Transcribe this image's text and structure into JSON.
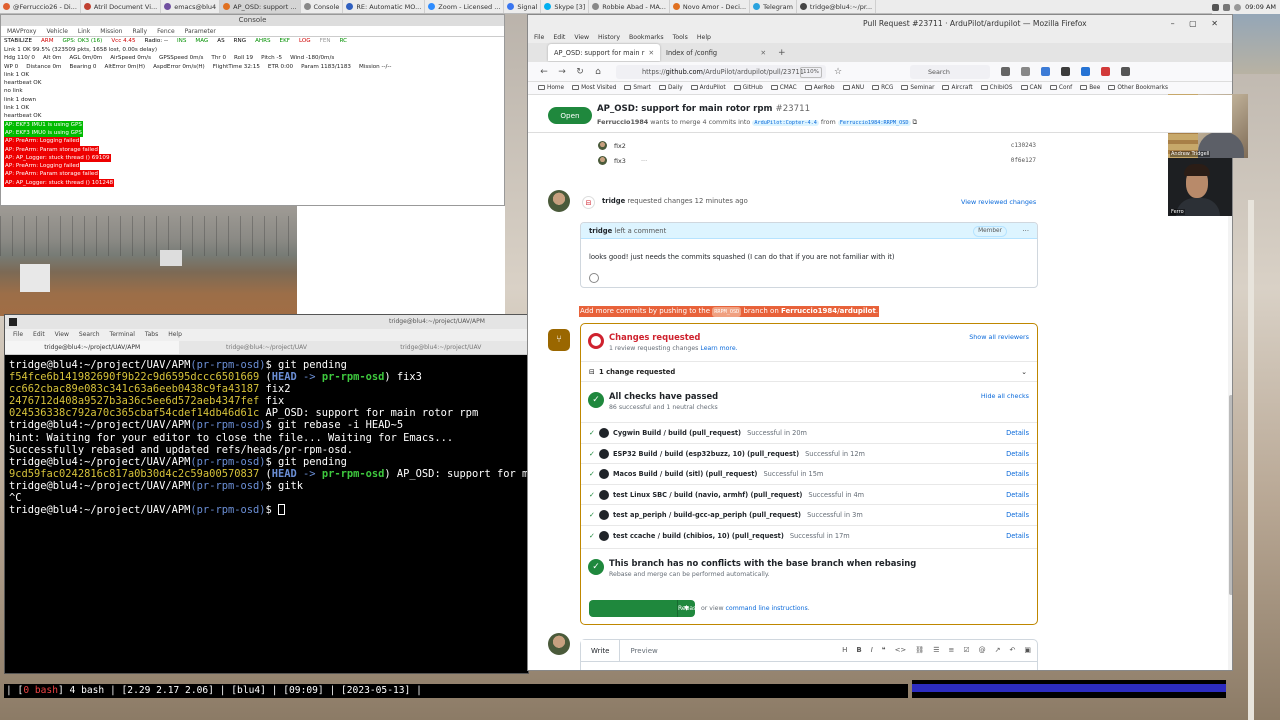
{
  "taskbar": {
    "items": [
      {
        "label": "@Ferruccio26 - Di...",
        "color": "#e06030"
      },
      {
        "label": "Atril Document Vi...",
        "color": "#c04030"
      },
      {
        "label": "emacs@blu4",
        "color": "#7050a0"
      },
      {
        "label": "AP_OSD: support ...",
        "color": "#e07020"
      },
      {
        "label": "Console",
        "color": "#888888"
      },
      {
        "label": "RE: Automatic MO...",
        "color": "#3060c0"
      },
      {
        "label": "Zoom - Licensed ...",
        "color": "#2d8cff"
      },
      {
        "label": "Signal",
        "color": "#3a76f0"
      },
      {
        "label": "Skype [3]",
        "color": "#00aff0"
      },
      {
        "label": "Robbie Abad - MA...",
        "color": "#888888"
      },
      {
        "label": "Novo Amor - Deci...",
        "color": "#e07020"
      },
      {
        "label": "Telegram",
        "color": "#2aa3de"
      },
      {
        "label": "tridge@blu4:~/pr...",
        "color": "#444444"
      }
    ],
    "active_index": 3,
    "clock": "09:09 AM"
  },
  "mavproxy": {
    "window_title": "Console",
    "menu": [
      "MAVProxy",
      "Vehicle",
      "Link",
      "Mission",
      "Rally",
      "Fence",
      "Parameter"
    ],
    "status_row1": [
      {
        "t": "STABILIZE",
        "c": "#000000"
      },
      {
        "t": "ARM",
        "c": "#d00000"
      },
      {
        "t": "GPS: OK3 (16)",
        "c": "#009000"
      },
      {
        "t": "Vcc 4.45",
        "c": "#d00000"
      },
      {
        "t": "Radio: --",
        "c": "#000000"
      },
      {
        "t": "INS",
        "c": "#009000"
      },
      {
        "t": "MAG",
        "c": "#009000"
      },
      {
        "t": "AS",
        "c": "#000000"
      },
      {
        "t": "RNG",
        "c": "#000000"
      },
      {
        "t": "AHRS",
        "c": "#009000"
      },
      {
        "t": "EKF",
        "c": "#009000"
      },
      {
        "t": "LOG",
        "c": "#d00000"
      },
      {
        "t": "FEN",
        "c": "#999999"
      },
      {
        "t": "RC",
        "c": "#009000"
      }
    ],
    "status_row2": "Link 1 OK 99.5% (323509 pkts, 1658 lost, 0.00s delay)",
    "status_row3": [
      "Hdg 110/ 0",
      "Alt 0m",
      "AGL 0m/0m",
      "AirSpeed 0m/s",
      "GPSSpeed 0m/s",
      "Thr 0",
      "Roll 19",
      "Pitch -5",
      "Wind -180/0m/s"
    ],
    "status_row4": [
      "WP 0",
      "Distance 0m",
      "Bearing 0",
      "AltError 0m(H)",
      "AspdError 0m/s(H)",
      "FlightTime 32:15",
      "ETR 0:00",
      "Param 1183/1183",
      "Mission --/--"
    ],
    "log_plain": [
      "link 1 OK",
      "heartbeat OK",
      "no link",
      "link 1 down",
      "link 1 OK",
      "heartbeat OK"
    ],
    "log_green": [
      "AP: EKF3 IMU1 is using GPS",
      "AP: EKF3 IMU0 is using GPS"
    ],
    "log_red": [
      "AP: PreArm: Logging failed",
      "AP: PreArm: Param storage failed",
      "AP: AP_Logger: stuck thread () 69109",
      "AP: PreArm: Logging failed",
      "AP: PreArm: Param storage failed",
      "AP: AP_Logger: stuck thread () 101248"
    ]
  },
  "terminal": {
    "window_title": "tridge@blu4:~/project/UAV/APM",
    "menu": [
      "File",
      "Edit",
      "View",
      "Search",
      "Terminal",
      "Tabs",
      "Help"
    ],
    "tabs": [
      "tridge@blu4:~/project/UAV/APM",
      "tridge@blu4:~/project/UAV",
      "tridge@blu4:~/project/UAV"
    ],
    "prompt_user": "tridge@blu4:~/project/UAV/APM",
    "prompt_branch": "(pr-rpm-osd)",
    "cmd1": "git pending",
    "commit1_hash": "f54fce6b141982690f9b22c9d6595dccc6501669",
    "head_label": "HEAD",
    "arrow": "->",
    "branch_label": "pr-rpm-osd",
    "commit1_msg": "fix3",
    "commit2_hash": "cc662cbac89e083c341c63a6eeb0438c9fa43187",
    "commit2_msg": "fix2",
    "commit3_hash": "2476712d408a9527b3a36c5ee6d572aeb4347fef",
    "commit3_msg": "fix",
    "commit4_hash": "024536338c792a70c365cbaf54cdef14db46d61c",
    "commit4_msg": "AP_OSD: support for main rotor rpm",
    "cmd2": "git rebase -i HEAD~5",
    "out1": "hint: Waiting for your editor to close the file... Waiting for Emacs...",
    "out2": "Successfully rebased and updated refs/heads/pr-rpm-osd.",
    "cmd3": "git pending",
    "commit5_hash": "9cd59fac0242816c817a0b30d4c2c59a00570837",
    "commit5_msg": "AP_OSD: support for main",
    "cmd4": "gitk",
    "ctrlc": "^C"
  },
  "tmux": {
    "text_pre": "| [",
    "window": "0 bash",
    "text_post": "] 4 bash | [2.29 2.17 2.06] | [blu4] | [09:09] | [2023-05-13] |"
  },
  "firefox": {
    "window_title": "Pull Request #23711 · ArduPilot/ardupilot — Mozilla Firefox",
    "menu": [
      "File",
      "Edit",
      "View",
      "History",
      "Bookmarks",
      "Tools",
      "Help"
    ],
    "tabs": [
      {
        "label": "AP_OSD: support for main r"
      },
      {
        "label": "Index of /config"
      }
    ],
    "url_prefix": "https://",
    "url_host": "github.com",
    "url_path": "/ArduPilot/ardupilot/pull/23711",
    "zoom": "110%",
    "search_placeholder": "Search",
    "bookmarks": [
      "Home",
      "Most Visited",
      "Smart",
      "Daily",
      "ArduPilot",
      "GitHub",
      "CMAC",
      "AerRob",
      "ANU",
      "RCG",
      "Seminar",
      "Aircraft",
      "ChibiOS",
      "CAN",
      "Conf",
      "Bee",
      "Other Bookmarks"
    ]
  },
  "pr": {
    "state": "Open",
    "title": "AP_OSD: support for main rotor rpm",
    "number": "#23711",
    "author": "Ferruccio1984",
    "sub_mid": " wants to merge 4 commits into ",
    "base_branch": "ArduPilot:Copter-4.4",
    "sub_from": " from ",
    "head_branch": "Ferruccio1984:RRPM_OSD",
    "commits": [
      {
        "msg": "fix2",
        "hash": "c130243"
      },
      {
        "msg": "fix3",
        "hash": "0f6e127"
      }
    ],
    "review": {
      "user": "tridge",
      "text": " requested changes 12 minutes ago",
      "link": "View reviewed changes"
    },
    "comment": {
      "user": "tridge",
      "text": " left a comment",
      "badge": "Member",
      "body": "looks good! just needs the commits squashed (I can do that if you are not familiar with it)"
    },
    "add_more": {
      "pre": "Add more commits by pushing to the ",
      "branch": "RRPM_OSD",
      "mid": " branch on ",
      "repo": "Ferruccio1984/ardupilot",
      "post": "."
    },
    "changes": {
      "title": "Changes requested",
      "sub": "1 review requesting changes ",
      "learn": "Learn more.",
      "show": "Show all reviewers",
      "count": "1 change requested"
    },
    "checks": {
      "title": "All checks have passed",
      "sub": "86 successful and 1 neutral checks",
      "hide": "Hide all checks",
      "details_label": "Details",
      "items": [
        {
          "name": "Cygwin Build / build (pull_request)",
          "status": "Successful in 20m"
        },
        {
          "name": "ESP32 Build / build (esp32buzz, 10) (pull_request)",
          "status": "Successful in 12m"
        },
        {
          "name": "Macos Build / build (sitl) (pull_request)",
          "status": "Successful in 15m"
        },
        {
          "name": "test Linux SBC / build (navio, armhf) (pull_request)",
          "status": "Successful in 4m"
        },
        {
          "name": "test ap_periph / build-gcc-ap_periph (pull_request)",
          "status": "Successful in 3m"
        },
        {
          "name": "test ccache / build (chibios, 10) (pull_request)",
          "status": "Successful in 17m"
        }
      ]
    },
    "conflicts": {
      "title": "This branch has no conflicts with the base branch when rebasing",
      "sub": "Rebase and merge can be performed automatically."
    },
    "merge_button": "Rebase and merge",
    "or_view": "or view ",
    "cli": "command line instructions",
    "write_tab": "Write",
    "preview_tab": "Preview"
  },
  "webcams": {
    "cam1_label": "Andrew Tridgell",
    "cam2_label": "Ferro"
  }
}
